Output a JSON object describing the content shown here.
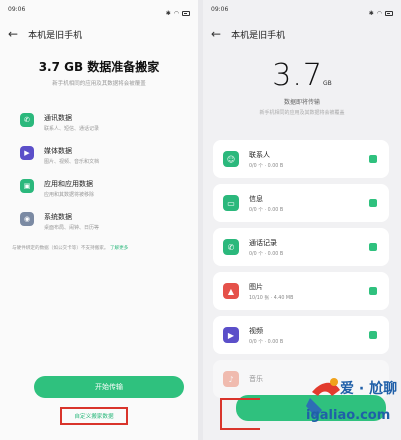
{
  "left_screen": {
    "status_time": "09:06",
    "header_title": "本机是旧手机",
    "big_title": "3.7 GB 数据准备搬家",
    "subtitle": "新手机相同的应用及其数据将会被覆盖",
    "categories": [
      {
        "name": "通讯数据",
        "desc": "联系人、短信、通话记录",
        "icon": "phone-icon",
        "color": "#2bb87c"
      },
      {
        "name": "媒体数据",
        "desc": "图片、视频、音乐和文档",
        "icon": "play-icon",
        "color": "#5b4fc9"
      },
      {
        "name": "应用和应用数据",
        "desc": "应用和其数据将被移除",
        "icon": "app-icon",
        "color": "#2bb87c"
      },
      {
        "name": "系统数据",
        "desc": "桌面布局、闹钟、日历等",
        "icon": "system-icon",
        "color": "#7b8aa3"
      }
    ],
    "note": "与硬件绑定的数据（如公交卡等）不支持搬家。",
    "note_link": "了解更多",
    "start_button": "开始传输",
    "custom_link": "自定义搬家数据"
  },
  "right_screen": {
    "status_time": "09:06",
    "header_title": "本机是旧手机",
    "big_number": "3.7",
    "unit": "GB",
    "subtitle1": "数据即将传输",
    "subtitle2": "新手机相同的应用及其数据将会被覆盖",
    "cards": [
      {
        "name": "联系人",
        "info": "0/0 个  ·  0.00 B",
        "icon": "contact-icon",
        "color": "#2bb87c"
      },
      {
        "name": "信息",
        "info": "0/0 个  ·  0.00 B",
        "icon": "message-icon",
        "color": "#2bb87c"
      },
      {
        "name": "通话记录",
        "info": "0/0 个  ·  0.00 B",
        "icon": "phone-icon",
        "color": "#2bb87c"
      },
      {
        "name": "图片",
        "info": "10/10 张  ·  4.40 MB",
        "icon": "photo-icon",
        "color": "#e5514a"
      },
      {
        "name": "视频",
        "info": "0/0 个  ·  0.00 B",
        "icon": "play-icon",
        "color": "#5b4fc9"
      },
      {
        "name": "音乐",
        "info": "",
        "icon": "music-icon",
        "color": "#f07a5f"
      }
    ]
  },
  "watermark": {
    "text_top": "爱 · 尬聊",
    "text_bottom": "igaliao.com"
  }
}
